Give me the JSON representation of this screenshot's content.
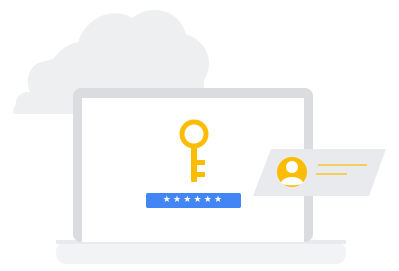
{
  "illustration": {
    "subject": "",
    "password_mask": "★★★★★★",
    "colors": {
      "background": "#ffffff",
      "cloud": "#eeeff1",
      "laptop_bezel": "#dadce0",
      "laptop_screen": "#ffffff",
      "laptop_base": "#f1f3f4",
      "key": "#fbbc04",
      "password_field": "#4285f4",
      "profile_card": "#e8eaed",
      "avatar_circle": "#fbbc04",
      "avatar_figure": "#ffffff",
      "card_lines": "#fbbc04"
    },
    "icons": [
      "cloud-icon",
      "laptop-icon",
      "key-icon",
      "password-field-icon",
      "profile-card-icon",
      "avatar-icon"
    ]
  }
}
